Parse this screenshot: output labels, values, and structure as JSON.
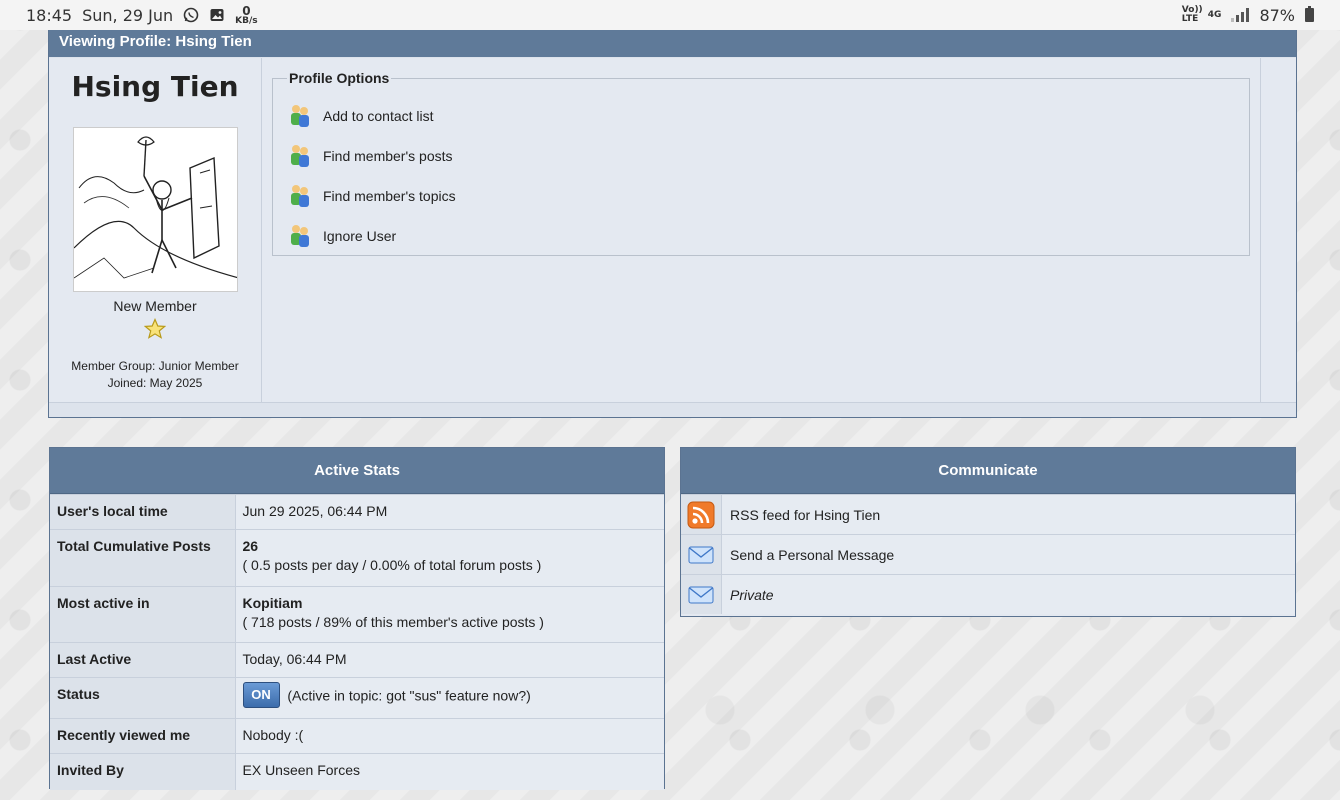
{
  "statusbar": {
    "time": "18:45",
    "date": "Sun, 29 Jun",
    "net_speed_value": "0",
    "net_speed_unit": "KB/s",
    "volte_label": "Vo)) LTE",
    "network_label": "4G",
    "battery": "87%"
  },
  "profile": {
    "header": "Viewing Profile: Hsing Tien",
    "username": "Hsing Tien",
    "rank": "New Member",
    "member_group": "Member Group: Junior Member",
    "joined": "Joined: May 2025",
    "options_legend": "Profile Options",
    "options": [
      {
        "label": "Add to contact list",
        "icon": "members-icon"
      },
      {
        "label": "Find member's posts",
        "icon": "members-icon"
      },
      {
        "label": "Find member's topics",
        "icon": "members-icon"
      },
      {
        "label": "Ignore User",
        "icon": "members-icon"
      }
    ]
  },
  "stats": {
    "title": "Active Stats",
    "rows": [
      {
        "label": "User's local time",
        "value": "Jun 29 2025, 06:44 PM",
        "sub": ""
      },
      {
        "label": "Total Cumulative Posts",
        "value": "26",
        "sub": "( 0.5 posts per day / 0.00% of total forum posts )"
      },
      {
        "label": "Most active in",
        "value": "Kopitiam",
        "sub": "( 718 posts / 89% of this member's active posts )"
      },
      {
        "label": "Last Active",
        "value": "Today, 06:44 PM",
        "sub": ""
      },
      {
        "label": "Status",
        "badge": "ON",
        "value": "(Active in topic: got \"sus\" feature now?)",
        "sub": ""
      },
      {
        "label": "Recently viewed me",
        "value": "Nobody :(",
        "sub": ""
      },
      {
        "label": "Invited By",
        "value": "EX Unseen Forces",
        "sub": ""
      }
    ]
  },
  "communicate": {
    "title": "Communicate",
    "rows": [
      {
        "label": "RSS feed for Hsing Tien",
        "icon": "rss-icon"
      },
      {
        "label": "Send a Personal Message",
        "icon": "envelope-icon"
      },
      {
        "label": "Private",
        "icon": "envelope-icon"
      }
    ]
  },
  "colors": {
    "header_bg": "#5f7a99",
    "panel_bg": "#e4e9f1",
    "border": "#5b7391"
  }
}
